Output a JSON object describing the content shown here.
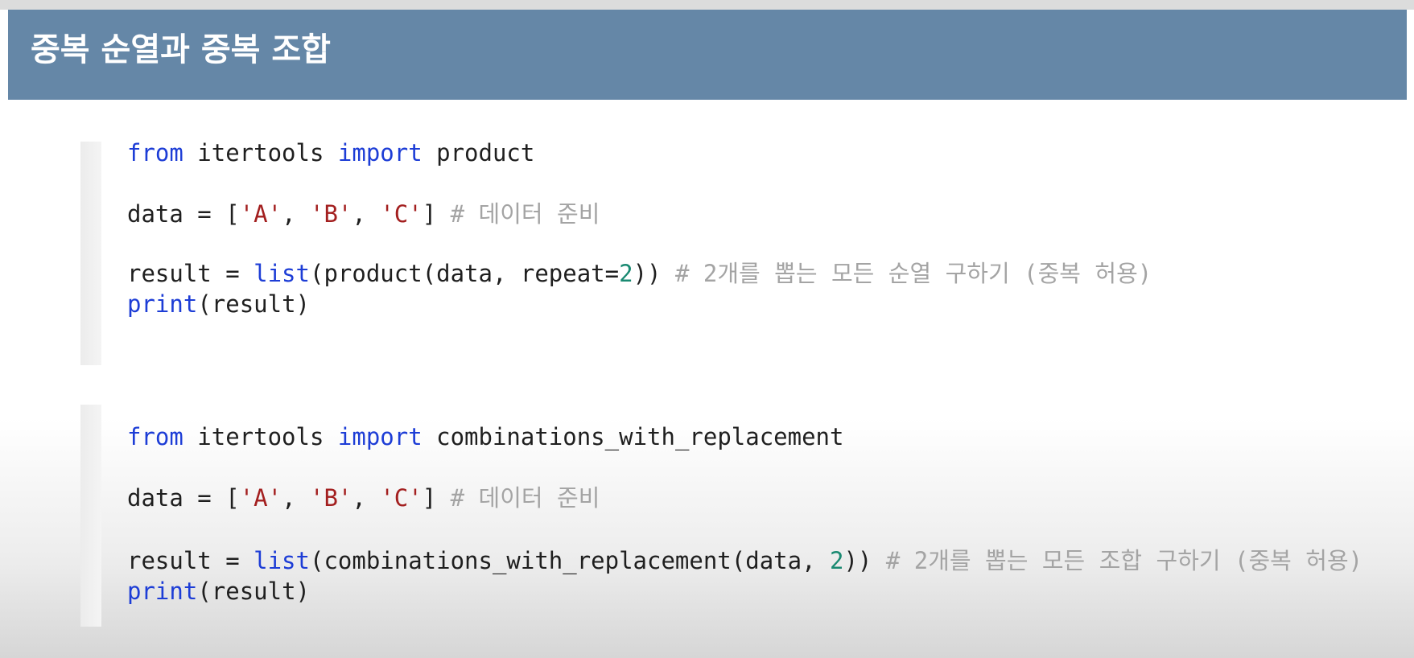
{
  "slide": {
    "title": "중복 순열과 중복 조합"
  },
  "code_blocks": [
    {
      "lines": [
        {
          "import_kw_from": "from",
          "module": " itertools ",
          "import_kw": "import",
          "name": " product"
        },
        {
          "var": "data = [",
          "s1": "'A'",
          "c1": ", ",
          "s2": "'B'",
          "c2": ", ",
          "s3": "'C'",
          "end": "] ",
          "comment": "# 데이터 준비"
        },
        {
          "var": "result = ",
          "fn": "list",
          "args": "(product(data, repeat=",
          "num": "2",
          "close": ")) ",
          "comment": "# 2개를 뽑는 모든 순열 구하기 (중복 허용)"
        },
        {
          "fn": "print",
          "args": "(result)"
        }
      ]
    },
    {
      "lines": [
        {
          "import_kw_from": "from",
          "module": " itertools ",
          "import_kw": "import",
          "name": " combinations_with_replacement"
        },
        {
          "var": "data = [",
          "s1": "'A'",
          "c1": ", ",
          "s2": "'B'",
          "c2": ", ",
          "s3": "'C'",
          "end": "] ",
          "comment": "# 데이터 준비"
        },
        {
          "var": "result = ",
          "fn": "list",
          "args": "(combinations_with_replacement(data, ",
          "num": "2",
          "close": ")) ",
          "comment": "# 2개를 뽑는 모든 조합 구하기 (중복 허용)"
        },
        {
          "fn": "print",
          "args": "(result)"
        }
      ]
    }
  ],
  "colors": {
    "header_bg": "#6587a7",
    "keyword": "#1d3dd6",
    "string": "#a31f1f",
    "number": "#1a8a72",
    "comment": "#a4a4a4"
  }
}
